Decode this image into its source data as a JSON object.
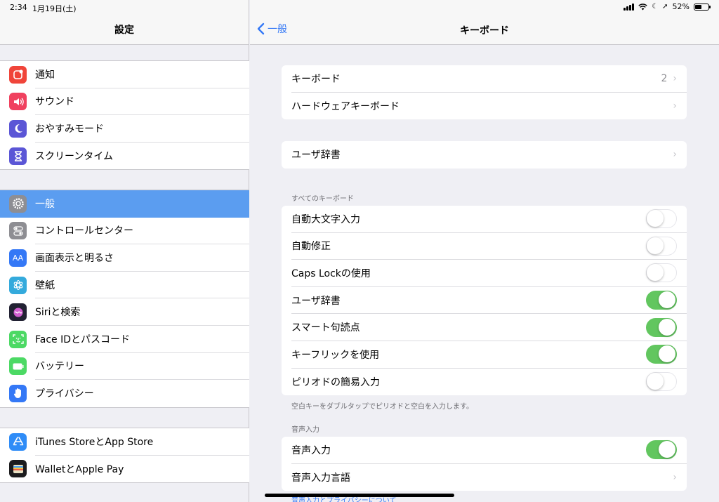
{
  "status": {
    "time": "2:34",
    "date": "1月19日(土)",
    "battery": "52%",
    "battery_level": 0.52
  },
  "sidebar": {
    "title": "設定",
    "groups": [
      [
        {
          "label": "通知",
          "icon": "notifications-icon",
          "color": "#f0453a"
        },
        {
          "label": "サウンド",
          "icon": "sound-icon",
          "color": "#f0415f"
        },
        {
          "label": "おやすみモード",
          "icon": "moon-icon",
          "color": "#5b56d6"
        },
        {
          "label": "スクリーンタイム",
          "icon": "hourglass-icon",
          "color": "#5b56d6"
        }
      ],
      [
        {
          "label": "一般",
          "icon": "gear-icon",
          "color": "#8e8e93",
          "selected": true
        },
        {
          "label": "コントロールセンター",
          "icon": "control-center-icon",
          "color": "#8e8e93"
        },
        {
          "label": "画面表示と明るさ",
          "icon": "display-icon",
          "color": "#3478f6"
        },
        {
          "label": "壁紙",
          "icon": "wallpaper-icon",
          "color": "#34aadc"
        },
        {
          "label": "Siriと検索",
          "icon": "siri-icon",
          "color": "#222233"
        },
        {
          "label": "Face IDとパスコード",
          "icon": "face-id-icon",
          "color": "#4cd964"
        },
        {
          "label": "バッテリー",
          "icon": "battery-icon",
          "color": "#4cd964"
        },
        {
          "label": "プライバシー",
          "icon": "privacy-hand-icon",
          "color": "#3478f6"
        }
      ],
      [
        {
          "label": "iTunes StoreとApp Store",
          "icon": "app-store-icon",
          "color": "#2f8cf7"
        },
        {
          "label": "WalletとApple Pay",
          "icon": "wallet-icon",
          "color": "#1c1c1e"
        }
      ]
    ]
  },
  "nav": {
    "back_label": "一般",
    "title": "キーボード"
  },
  "keyboards": {
    "label": "キーボード",
    "count": "2"
  },
  "hardware_keyboard": "ハードウェアキーボード",
  "user_dictionary_link": "ユーザ辞書",
  "all_keyboards": {
    "header": "すべてのキーボード",
    "rows": [
      {
        "label": "自動大文字入力",
        "on": false
      },
      {
        "label": "自動修正",
        "on": false
      },
      {
        "label": "Caps Lockの使用",
        "on": false
      },
      {
        "label": "ユーザ辞書",
        "on": true
      },
      {
        "label": "スマート句読点",
        "on": true
      },
      {
        "label": "キーフリックを使用",
        "on": true
      },
      {
        "label": "ピリオドの簡易入力",
        "on": false
      }
    ],
    "footer": "空白キーをダブルタップでピリオドと空白を入力します。"
  },
  "dictation": {
    "header": "音声入力",
    "toggle_label": "音声入力",
    "toggle_on": true,
    "language_label": "音声入力言語",
    "privacy_link": "音声入力とプライバシーについて"
  },
  "colors": {
    "accent": "#3478f6",
    "toggle_on": "#62c65f",
    "selected_row": "#5b9df0"
  }
}
